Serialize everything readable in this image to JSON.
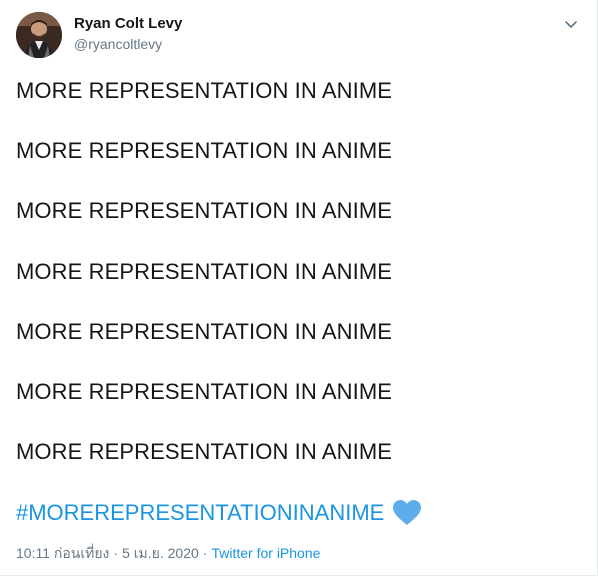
{
  "author": {
    "display_name": "Ryan Colt Levy",
    "handle": "@ryancoltlevy"
  },
  "tweet": {
    "lines": [
      "MORE REPRESENTATION IN ANIME",
      "MORE REPRESENTATION IN ANIME",
      "MORE REPRESENTATION IN ANIME",
      "MORE REPRESENTATION IN ANIME",
      "MORE REPRESENTATION IN ANIME",
      "MORE REPRESENTATION IN ANIME",
      "MORE REPRESENTATION IN ANIME"
    ],
    "hashtag": "#MOREREPRESENTATIONINANIME",
    "emoji": "blue-heart"
  },
  "meta": {
    "time": "10:11 ก่อนเที่ยง",
    "separator": "·",
    "date": "5 เม.ย. 2020",
    "source": "Twitter for iPhone"
  },
  "icons": {
    "menu": "chevron-down-icon"
  },
  "colors": {
    "link": "#1b95e0",
    "secondary_text": "#657786",
    "heart": "#5dadec"
  }
}
